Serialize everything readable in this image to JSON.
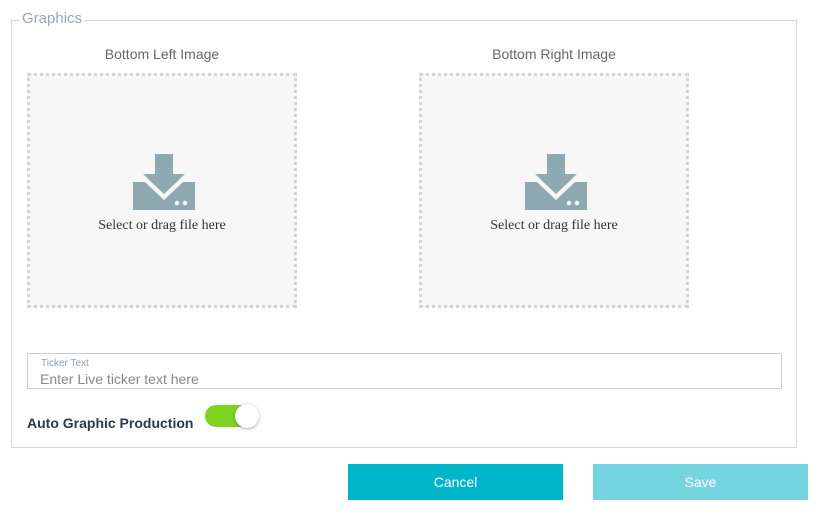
{
  "section": {
    "legend": "Graphics"
  },
  "uploads": [
    {
      "title": "Bottom Left Image",
      "prompt": "Select or drag file here",
      "icon": "download-tray-icon"
    },
    {
      "title": "Bottom Right Image",
      "prompt": "Select or drag file here",
      "icon": "download-tray-icon"
    }
  ],
  "ticker": {
    "label": "Ticker Text",
    "placeholder": "Enter Live ticker text here",
    "value": ""
  },
  "auto_graphic": {
    "label": "Auto Graphic Production",
    "enabled": true
  },
  "buttons": {
    "cancel": "Cancel",
    "save": "Save"
  },
  "colors": {
    "accent": "#00b4c9",
    "save_disabled": "#74d5e1",
    "toggle_on": "#7ed321",
    "icon": "#8fa9b0",
    "dropzone_bg": "#f7f7f7"
  }
}
